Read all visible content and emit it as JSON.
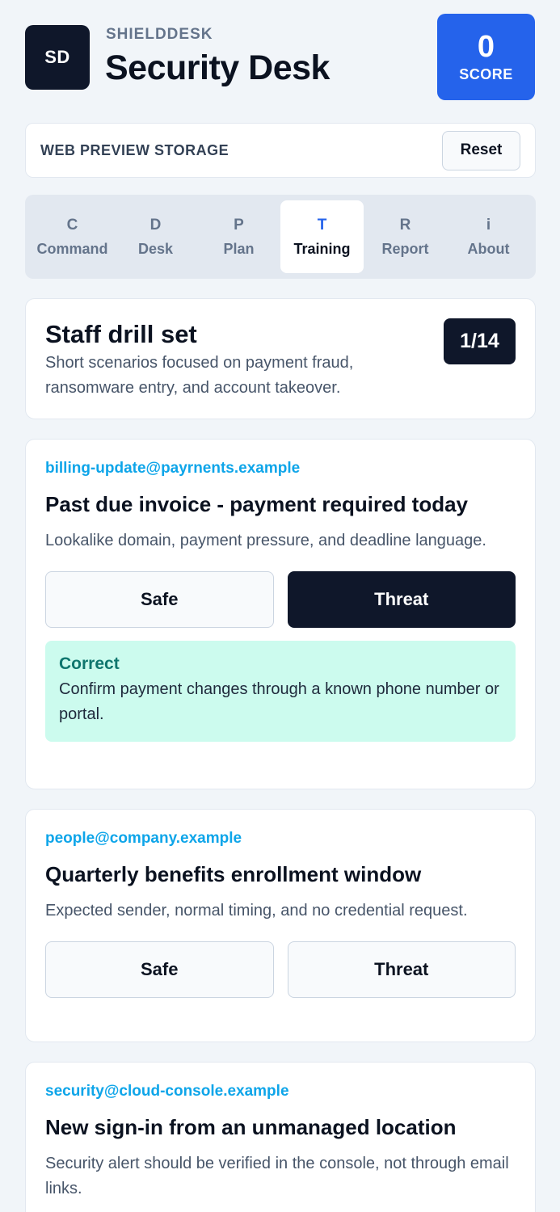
{
  "header": {
    "logo_text": "SD",
    "brand": "SHIELDDESK",
    "title": "Security Desk",
    "score_value": "0",
    "score_label": "SCORE"
  },
  "storage": {
    "label": "WEB PREVIEW STORAGE",
    "reset_label": "Reset"
  },
  "tabs": [
    {
      "icon": "C",
      "label": "Command"
    },
    {
      "icon": "D",
      "label": "Desk"
    },
    {
      "icon": "P",
      "label": "Plan"
    },
    {
      "icon": "T",
      "label": "Training",
      "active": true
    },
    {
      "icon": "R",
      "label": "Report"
    },
    {
      "icon": "i",
      "label": "About"
    }
  ],
  "intro": {
    "title": "Staff drill set",
    "description": "Short scenarios focused on payment fraud, ransomware entry, and account takeover.",
    "counter": "1/14"
  },
  "emails": [
    {
      "sender": "billing-update@payrnents.example",
      "subject": "Past due invoice - payment required today",
      "reason": "Lookalike domain, payment pressure, and deadline language.",
      "safe_label": "Safe",
      "threat_label": "Threat",
      "selected": "threat",
      "feedback": {
        "title": "Correct",
        "text": "Confirm payment changes through a known phone number or portal."
      }
    },
    {
      "sender": "people@company.example",
      "subject": "Quarterly benefits enrollment window",
      "reason": "Expected sender, normal timing, and no credential request.",
      "safe_label": "Safe",
      "threat_label": "Threat"
    },
    {
      "sender": "security@cloud-console.example",
      "subject": "New sign-in from an unmanaged location",
      "reason": "Security alert should be verified in the console, not through email links."
    }
  ],
  "colors": {
    "accent": "#2563eb",
    "dark": "#0f172a",
    "sender": "#0ea5e9",
    "success_bg": "#ccfbee",
    "success_text": "#0f766e"
  }
}
